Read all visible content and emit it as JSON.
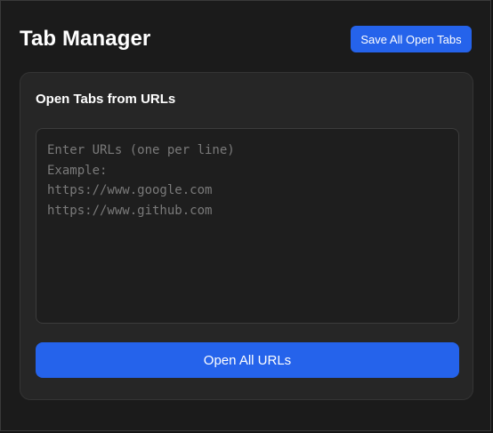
{
  "header": {
    "title": "Tab Manager",
    "save_all_label": "Save All Open Tabs"
  },
  "open_urls_card": {
    "title": "Open Tabs from URLs",
    "textarea_placeholder": "Enter URLs (one per line)\nExample:\nhttps://www.google.com\nhttps://www.github.com",
    "textarea_value": "",
    "open_all_label": "Open All URLs"
  },
  "colors": {
    "accent": "#2563eb",
    "background": "#1b1b1b",
    "card": "#262626",
    "input": "#1e1e1e"
  }
}
